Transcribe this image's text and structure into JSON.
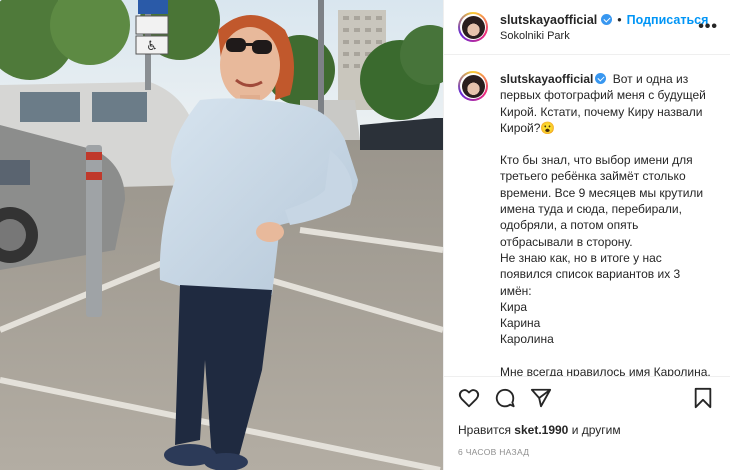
{
  "photo": {
    "alt": "",
    "sign_icon": "wheelchair-parking-sign"
  },
  "header": {
    "username": "slutskayaofficial",
    "separator": "•",
    "follow_label": "Подписаться",
    "location": "Sokolniki Park",
    "more_icon": "more-options-icon"
  },
  "caption": {
    "username": "slutskayaofficial",
    "first_line": "Вот и одна из первых фотографий меня с будущей Кирой. Кстати, почему Киру назвали Кирой?😮",
    "para2": "Кто бы знал, что выбор имени для третьего ребёнка займёт столько времени. Все 9 месяцев мы крутили имена туда и сюда, перебирали, одобряли, а потом опять отбрасывали в сторону.",
    "para3": "Не знаю как, но в итоге у нас появился список вариантов их 3 имён:",
    "names": [
      "Кира",
      "Карина",
      "Каролина"
    ],
    "para4": "Мне всегда нравилось имя Каролина. Оно редкое и красиво"
  },
  "actions": {
    "icons": [
      "heart-icon",
      "comment-icon",
      "share-icon",
      "bookmark-icon"
    ],
    "likes_prefix": "Нравится",
    "likes_user": "sket.1990",
    "likes_suffix": "и другим",
    "time": "6 часов назад"
  },
  "colors": {
    "accent": "#0095f6",
    "verified": "#3897f0",
    "text": "#262626",
    "muted": "#8e8e8e",
    "divider": "#efefef"
  }
}
